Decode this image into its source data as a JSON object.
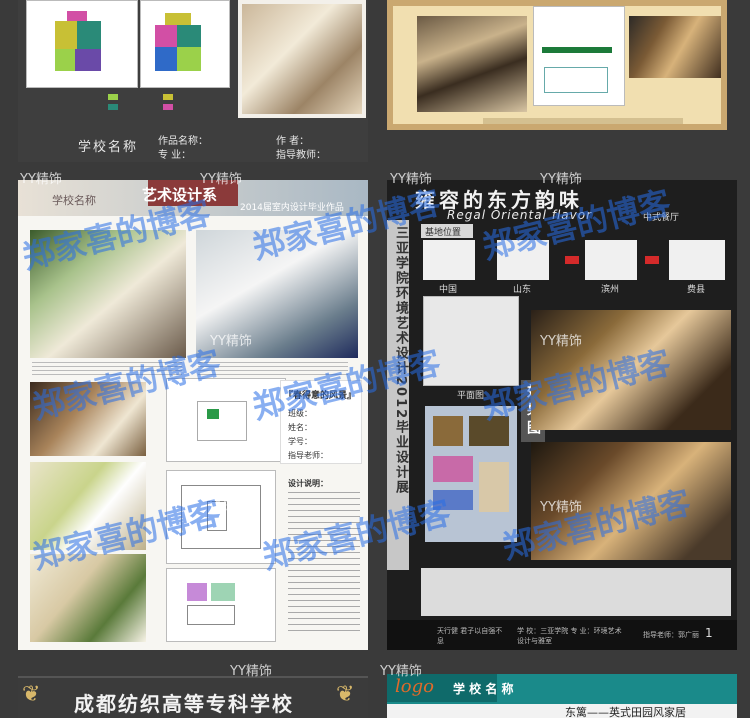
{
  "top_left": {
    "school_label": "学校名称",
    "work_label": "作品名称：",
    "major_label": "专   业：",
    "author_label": "作   者：",
    "advisor_label": "指导教师："
  },
  "mid_left": {
    "school": "学校名称",
    "art_title": "艺术设计系",
    "subtitle": "2014届室内设计毕业作品",
    "info_title": "『春得意的风景』",
    "name_label": "班级：",
    "name2_label": "姓名：",
    "id_label": "学号：",
    "advisor_label": "指导老师：",
    "design_label": "设计说明："
  },
  "mid_right": {
    "title_cn": "雍容的东方韵味",
    "title_en": "Regal Oriental flavor",
    "title_tag": "中式餐厅",
    "base_label": "基地位置",
    "map_labels": [
      "中国",
      "山东",
      "滨州",
      "费县"
    ],
    "vertical_text": "三亚学院环境艺术设计2012毕业设计展",
    "effect_label": "效果图",
    "plan_label": "平面图",
    "footer_left": "天行健 君子以自强不息",
    "footer_mid": "学 校：三亚学院  专 业：环境艺术设计与雅室",
    "footer_right": "指导老师：郭广丽",
    "page_num": "1"
  },
  "bottom_left": {
    "title": "成都纺织高等专科学校"
  },
  "bottom_right": {
    "logo": "logo",
    "school": "学 校 名 称",
    "subtitle": "东篱——英式田园风家居"
  },
  "watermarks": {
    "blue_text": "郑家喜的博客",
    "yy_text": "YY精饰"
  }
}
